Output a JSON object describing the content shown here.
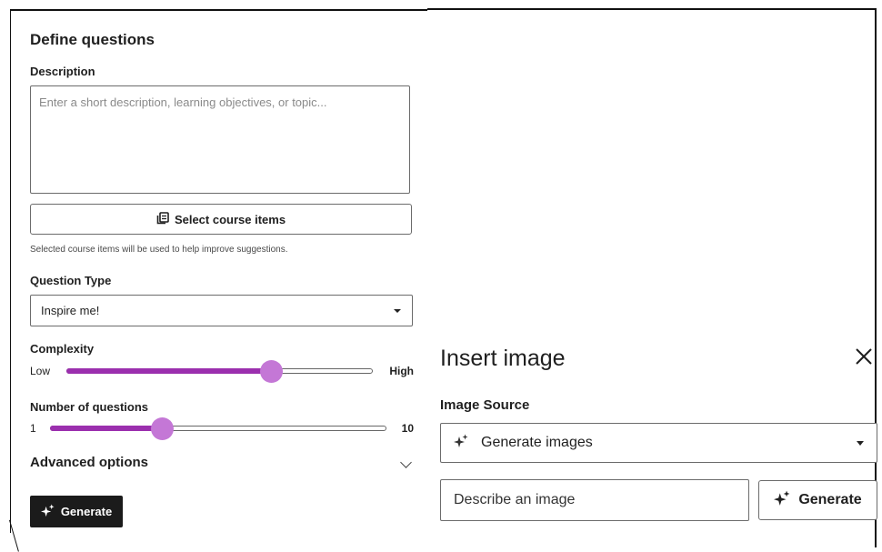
{
  "define_panel": {
    "title": "Define questions",
    "description_label": "Description",
    "description_placeholder": "Enter a short description, learning objectives, or topic...",
    "select_course_items_label": "Select course items",
    "select_course_items_hint": "Selected course items will be used to help improve suggestions.",
    "question_type_label": "Question Type",
    "question_type_value": "Inspire me!",
    "complexity": {
      "label": "Complexity",
      "low_label": "Low",
      "high_label": "High",
      "value_fraction": 0.67
    },
    "number_of_questions": {
      "label": "Number of questions",
      "min_label": "1",
      "max_label": "10",
      "value": 4
    },
    "advanced_options_label": "Advanced options",
    "generate_label": "Generate"
  },
  "insert_image_panel": {
    "title": "Insert image",
    "image_source_label": "Image Source",
    "image_source_value": "Generate images",
    "describe_placeholder": "Describe an image",
    "generate_label": "Generate"
  },
  "colors": {
    "accent": "#9b2fae",
    "thumb": "#c477d6",
    "dark_button": "#1b1b1b"
  },
  "icons": [
    "course-items-icon",
    "chevron-down-icon",
    "sparkle-icon",
    "close-icon"
  ]
}
